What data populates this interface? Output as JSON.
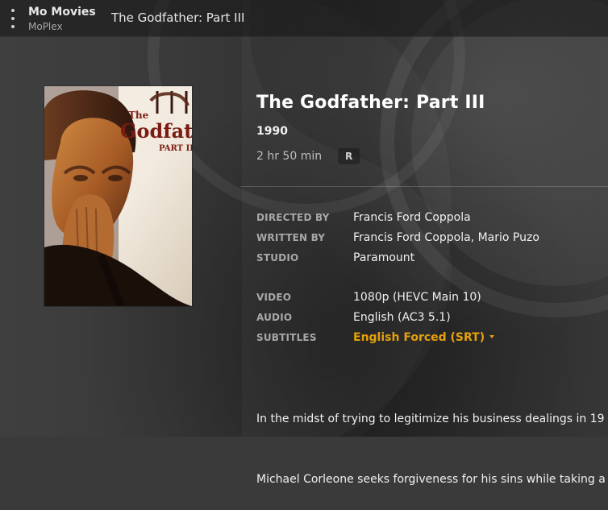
{
  "header": {
    "server_name": "Mo Movies",
    "server_sub": "MoPlex",
    "breadcrumb": "The Godfather: Part III"
  },
  "movie": {
    "title": "The Godfather: Part III",
    "year": "1990",
    "runtime": "2 hr 50 min",
    "rating": "R",
    "poster_title_the": "The",
    "poster_title_main": "Godfather",
    "poster_title_part": "PART III"
  },
  "meta": {
    "directed_by_label": "DIRECTED BY",
    "directed_by": "Francis Ford Coppola",
    "written_by_label": "WRITTEN BY",
    "written_by": "Francis Ford Coppola, Mario Puzo",
    "studio_label": "STUDIO",
    "studio": "Paramount",
    "video_label": "VIDEO",
    "video": "1080p (HEVC Main 10)",
    "audio_label": "AUDIO",
    "audio": "English (AC3 5.1)",
    "subtitles_label": "SUBTITLES",
    "subtitles": "English Forced (SRT)"
  },
  "summary": {
    "line1": "In the midst of trying to legitimize his business dealings in 19",
    "line2": "Michael Corleone seeks forgiveness for his sins while taking a"
  },
  "colors": {
    "accent": "#e5a00d"
  }
}
